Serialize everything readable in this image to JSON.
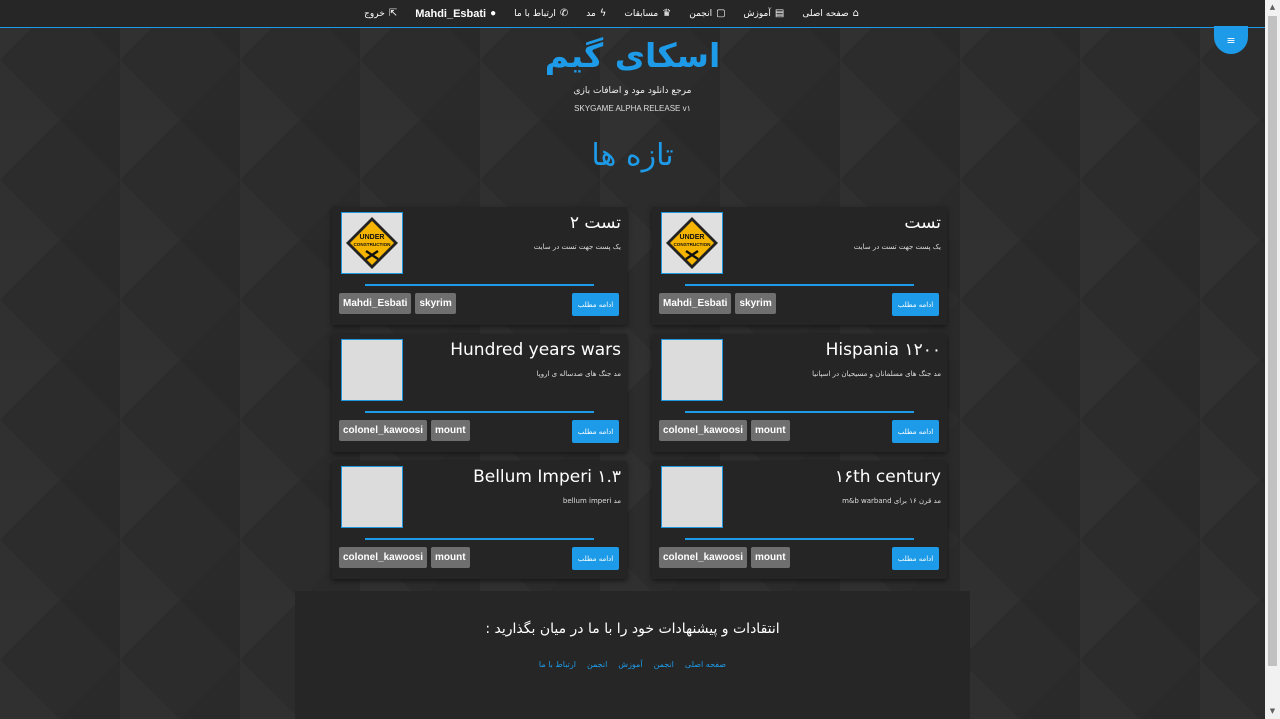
{
  "nav": {
    "items": [
      {
        "label": "صفحه اصلی",
        "icon": "home-icon",
        "glyph": "⌂"
      },
      {
        "label": "آموزش",
        "icon": "newspaper-icon",
        "glyph": "▤"
      },
      {
        "label": "انجمن",
        "icon": "chat-icon",
        "glyph": "▢"
      },
      {
        "label": "مسابقات",
        "icon": "trophy-icon",
        "glyph": "♛"
      },
      {
        "label": "مد",
        "icon": "bolt-icon",
        "glyph": "ϟ"
      },
      {
        "label": "ارتباط با ما",
        "icon": "phone-icon",
        "glyph": "✆"
      },
      {
        "label": "Mahdi_Esbati",
        "icon": "user-icon",
        "glyph": "●"
      },
      {
        "label": "خروج",
        "icon": "external-link-icon",
        "glyph": "⇱"
      }
    ],
    "menu_glyph": "≡"
  },
  "header": {
    "title": "اسکای گیم",
    "subtitle": "مرجع دانلود مود و اضافات بازی",
    "release": "SKYGAME ALPHA RELEASE v۱"
  },
  "section_title": "تازه ها",
  "more_label": "ادامه مطلب",
  "posts": [
    {
      "title": "تست",
      "desc": "یک پست جهت تست در سایت",
      "tags": [
        "Mahdi_Esbati",
        "skyrim"
      ],
      "image": "under-construction"
    },
    {
      "title": "تست ۲",
      "desc": "یک پست جهت تست در سایت",
      "tags": [
        "Mahdi_Esbati",
        "skyrim"
      ],
      "image": "under-construction"
    },
    {
      "title": "Hispania ۱۲۰۰",
      "desc": "مد جنگ های مسلمانان و مسیحیان در اسپانیا",
      "tags": [
        "colonel_kawoosi",
        "mount"
      ],
      "image": "empty"
    },
    {
      "title": "Hundred years wars",
      "desc": "مد جنگ های صدساله ی اروپا",
      "tags": [
        "colonel_kawoosi",
        "mount"
      ],
      "image": "empty"
    },
    {
      "title": "۱۶th century",
      "desc": "مد قرن ۱۶ برای m&b warband",
      "tags": [
        "colonel_kawoosi",
        "mount"
      ],
      "image": "empty"
    },
    {
      "title": "Bellum Imperi ۱.۳",
      "desc": "مد bellum imperi",
      "tags": [
        "colonel_kawoosi",
        "mount"
      ],
      "image": "empty"
    }
  ],
  "sign": {
    "line1": "UNDER",
    "line2": "CONSTRUCTION"
  },
  "footer": {
    "text": "انتقادات و پیشنهادات خود را با ما در میان بگذارید :",
    "links": [
      "صفحه اصلی",
      "انجمن",
      "آموزش",
      "انجمن",
      "ارتباط با ما"
    ]
  },
  "colors": {
    "accent": "#1e9be8",
    "background": "#2c2c2c",
    "card": "#252525",
    "tag": "#6f6f6f"
  }
}
